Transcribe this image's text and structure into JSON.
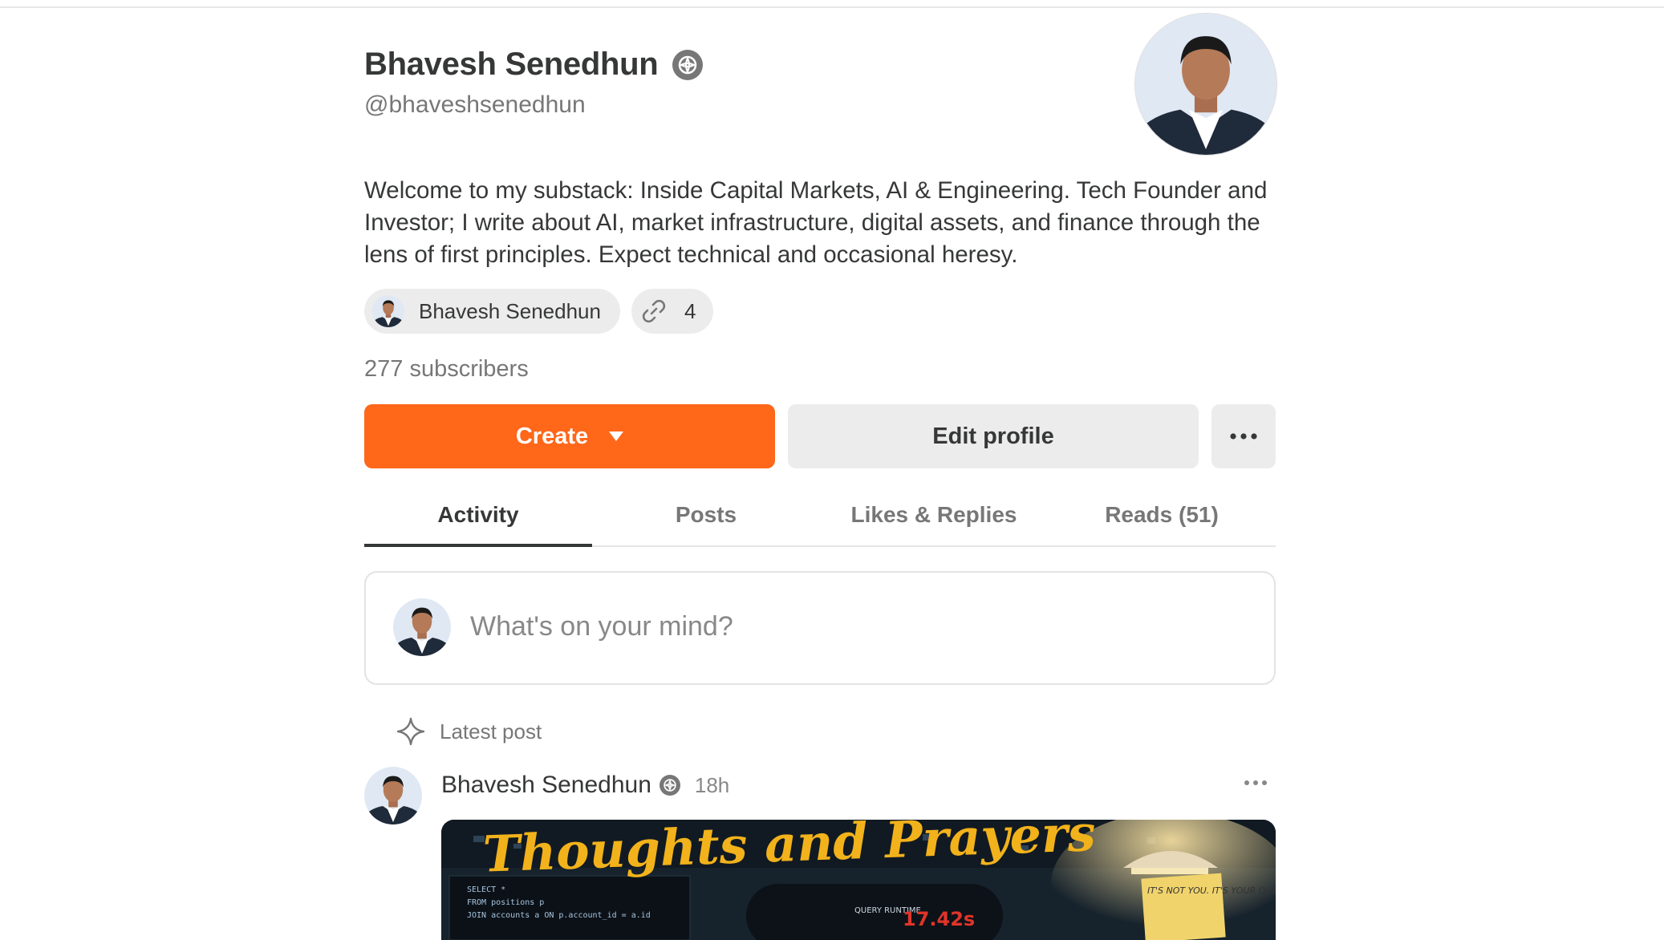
{
  "profile": {
    "name": "Bhavesh Senedhun",
    "handle": "@bhaveshsenedhun",
    "bio": "Welcome to my substack: Inside Capital Markets, AI & Engineering. Tech Founder and Investor; I write about AI, market infrastructure, digital assets, and finance through the lens of first principles. Expect technical and occasional heresy.",
    "subscribers": "277 subscribers"
  },
  "chips": {
    "publication_name": "Bhavesh Senedhun",
    "links_count": "4"
  },
  "actions": {
    "create_label": "Create",
    "edit_label": "Edit profile"
  },
  "tabs": [
    {
      "label": "Activity",
      "active": true
    },
    {
      "label": "Posts",
      "active": false
    },
    {
      "label": "Likes & Replies",
      "active": false
    },
    {
      "label": "Reads (51)",
      "active": false
    }
  ],
  "composer": {
    "placeholder": "What's on your mind?"
  },
  "feed": {
    "section_label": "Latest post",
    "post": {
      "author": "Bhavesh Senedhun",
      "time": "18h",
      "image_title": "Thoughts and Prayers",
      "image_code": [
        "SELECT *",
        "FROM positions p",
        "JOIN accounts a ON p.account_id = a.id"
      ],
      "image_runtime_label": "QUERY RUNTIME",
      "image_runtime_value": "17.42s",
      "image_note": "IT'S NOT YOU. IT'S YOUR QUERY"
    }
  },
  "colors": {
    "accent": "#ff6719",
    "text": "#363737",
    "muted": "#777777",
    "chip_bg": "#ececec"
  },
  "icons": [
    "verified-badge-icon",
    "link-icon",
    "caret-down-icon",
    "more-icon",
    "sparkle-icon"
  ]
}
